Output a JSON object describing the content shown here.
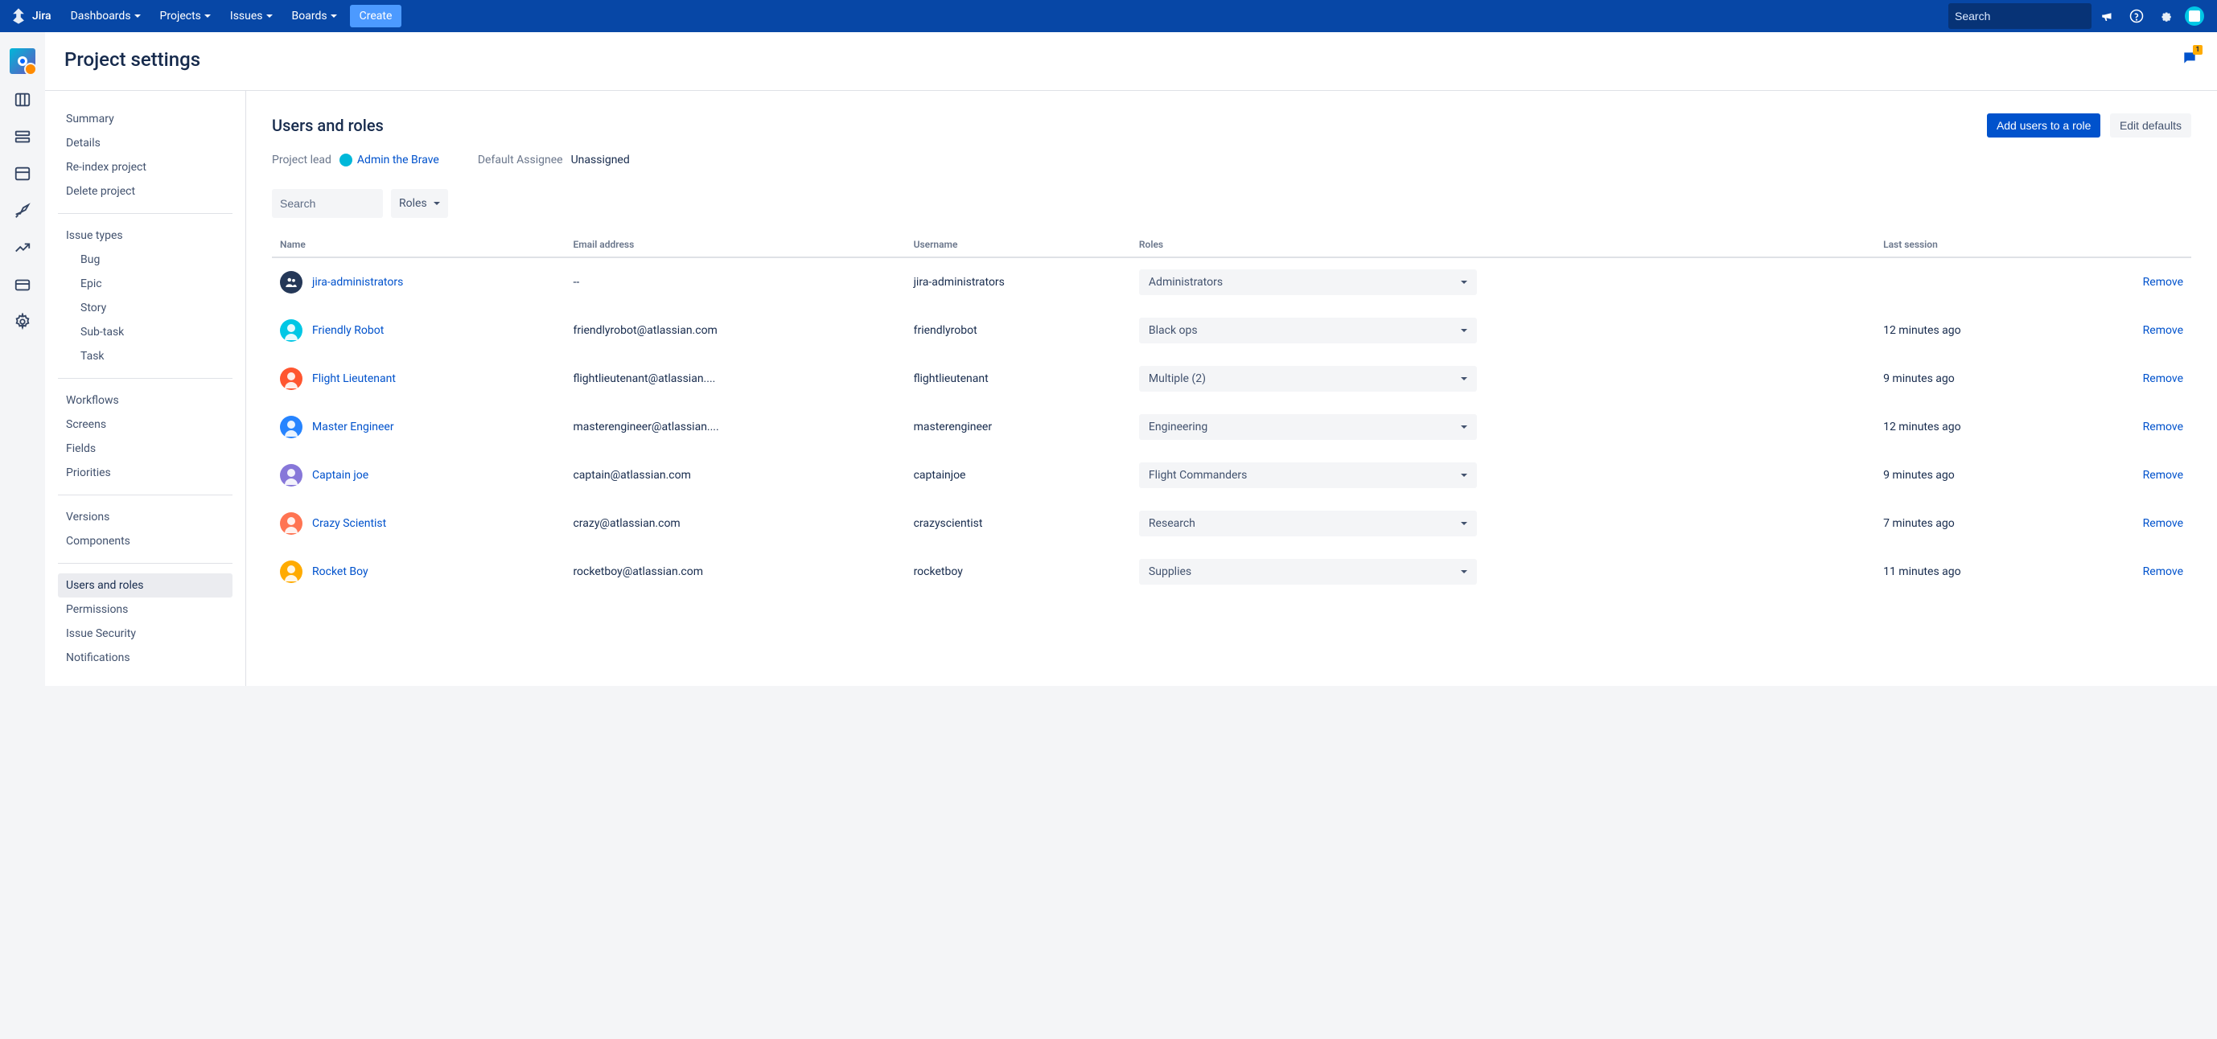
{
  "brand": "Jira",
  "topnav": {
    "items": [
      "Dashboards",
      "Projects",
      "Issues",
      "Boards"
    ],
    "create": "Create",
    "search_placeholder": "Search"
  },
  "page": {
    "title": "Project settings",
    "feedback_badge": "1"
  },
  "sidebar": {
    "group1": [
      "Summary",
      "Details",
      "Re-index project",
      "Delete project"
    ],
    "issue_types_heading": "Issue types",
    "issue_types": [
      "Bug",
      "Epic",
      "Story",
      "Sub-task",
      "Task"
    ],
    "group3": [
      "Workflows",
      "Screens",
      "Fields",
      "Priorities"
    ],
    "group4": [
      "Versions",
      "Components"
    ],
    "group5": [
      "Users and roles",
      "Permissions",
      "Issue Security",
      "Notifications"
    ],
    "active": "Users and roles"
  },
  "content": {
    "section_title": "Users and roles",
    "add_button": "Add users to a role",
    "edit_defaults": "Edit defaults",
    "project_lead_label": "Project lead",
    "project_lead_value": "Admin the Brave",
    "default_assignee_label": "Default Assignee",
    "default_assignee_value": "Unassigned",
    "search_placeholder": "Search",
    "roles_filter": "Roles",
    "columns": {
      "name": "Name",
      "email": "Email address",
      "username": "Username",
      "roles": "Roles",
      "last_session": "Last session"
    },
    "remove_label": "Remove",
    "rows": [
      {
        "name": "jira-administrators",
        "email": "--",
        "username": "jira-administrators",
        "role": "Administrators",
        "last_session": "",
        "is_group": true
      },
      {
        "name": "Friendly Robot",
        "email": "friendlyrobot@atlassian.com",
        "username": "friendlyrobot",
        "role": "Black ops",
        "last_session": "12 minutes ago",
        "is_group": false
      },
      {
        "name": "Flight Lieutenant",
        "email": "flightlieutenant@atlassian....",
        "username": "flightlieutenant",
        "role": "Multiple (2)",
        "last_session": "9 minutes ago",
        "is_group": false
      },
      {
        "name": "Master Engineer",
        "email": "masterengineer@atlassian....",
        "username": "masterengineer",
        "role": "Engineering",
        "last_session": "12 minutes ago",
        "is_group": false
      },
      {
        "name": "Captain joe",
        "email": "captain@atlassian.com",
        "username": "captainjoe",
        "role": "Flight Commanders",
        "last_session": "9 minutes ago",
        "is_group": false
      },
      {
        "name": "Crazy Scientist",
        "email": "crazy@atlassian.com",
        "username": "crazyscientist",
        "role": "Research",
        "last_session": "7 minutes ago",
        "is_group": false
      },
      {
        "name": "Rocket Boy",
        "email": "rocketboy@atlassian.com",
        "username": "rocketboy",
        "role": "Supplies",
        "last_session": "11 minutes ago",
        "is_group": false
      }
    ]
  }
}
